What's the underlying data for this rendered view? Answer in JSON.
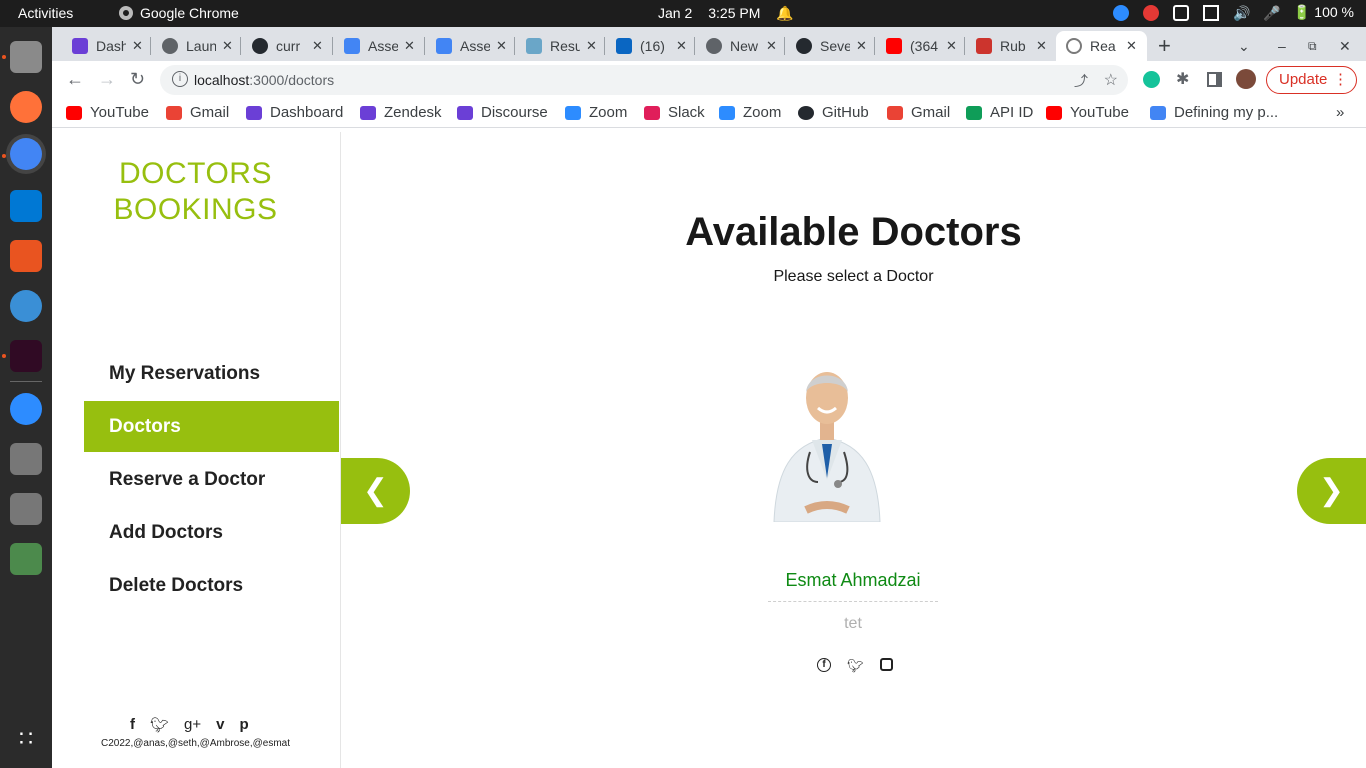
{
  "system": {
    "activities": "Activities",
    "app_name": "Google Chrome",
    "date": "Jan 2",
    "time": "3:25 PM",
    "battery": "100 %"
  },
  "browser": {
    "tabs": [
      {
        "label": "Dash",
        "color": "#6b3fd6"
      },
      {
        "label": "Laun",
        "color": "#5f6368"
      },
      {
        "label": "curr",
        "color": "#24292f"
      },
      {
        "label": "Asse",
        "color": "#4285f4"
      },
      {
        "label": "Asse",
        "color": "#4285f4"
      },
      {
        "label": "Resu",
        "color": "#6aa6c8"
      },
      {
        "label": "(16)",
        "color": "#0a66c2"
      },
      {
        "label": "New",
        "color": "#5f6368"
      },
      {
        "label": "Seve",
        "color": "#24292f"
      },
      {
        "label": "(364",
        "color": "#ff0000"
      },
      {
        "label": "Rub",
        "color": "#cc342d"
      },
      {
        "label": "Rea",
        "color": "#7a7a7a"
      }
    ],
    "url_host": "localhost",
    "url_path": ":3000/doctors",
    "update_label": "Update",
    "bookmarks": [
      {
        "label": "YouTube",
        "color": "#ff0000"
      },
      {
        "label": "Gmail",
        "color": "#ea4335"
      },
      {
        "label": "Dashboard",
        "color": "#6b3fd6"
      },
      {
        "label": "Zendesk",
        "color": "#6b3fd6"
      },
      {
        "label": "Discourse",
        "color": "#6b3fd6"
      },
      {
        "label": "Zoom",
        "color": "#2d8cff"
      },
      {
        "label": "Slack",
        "color": "#e01e5a"
      },
      {
        "label": "Zoom",
        "color": "#2d8cff"
      },
      {
        "label": "GitHub",
        "color": "#24292f"
      },
      {
        "label": "Gmail",
        "color": "#ea4335"
      },
      {
        "label": "API ID",
        "color": "#0f9d58"
      },
      {
        "label": "YouTube",
        "color": "#ff0000"
      },
      {
        "label": "Defining my p...",
        "color": "#4285f4"
      }
    ]
  },
  "app": {
    "logo_line1": "DOCTORS",
    "logo_line2": "BOOKINGS",
    "nav": [
      "My Reservations",
      "Doctors",
      "Reserve a Doctor",
      "Add Doctors",
      "Delete Doctors"
    ],
    "active_nav": "Doctors",
    "footer_icons": [
      "facebook-icon",
      "twitter-icon",
      "google-plus-icon",
      "vimeo-icon",
      "pinterest-icon"
    ],
    "copyright": "C2022,@anas,@seth,@Ambrose,@esmat",
    "title": "Available Doctors",
    "subtitle": "Please select a Doctor",
    "prev_label": "❮",
    "next_label": "❯",
    "doctor": {
      "name": "Esmat Ahmadzai",
      "specialty": "tet",
      "social": [
        "facebook-icon",
        "twitter-icon",
        "instagram-icon"
      ]
    },
    "accent": "#97bf0f"
  }
}
